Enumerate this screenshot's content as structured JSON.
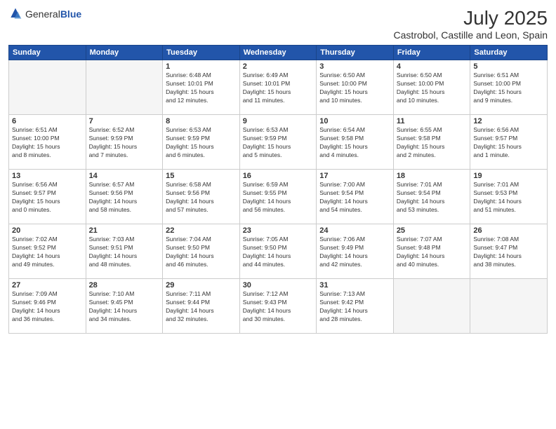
{
  "logo": {
    "general": "General",
    "blue": "Blue"
  },
  "title": "July 2025",
  "subtitle": "Castrobol, Castille and Leon, Spain",
  "weekdays": [
    "Sunday",
    "Monday",
    "Tuesday",
    "Wednesday",
    "Thursday",
    "Friday",
    "Saturday"
  ],
  "days": [
    {
      "num": "",
      "info": ""
    },
    {
      "num": "",
      "info": ""
    },
    {
      "num": "1",
      "info": "Sunrise: 6:48 AM\nSunset: 10:01 PM\nDaylight: 15 hours\nand 12 minutes."
    },
    {
      "num": "2",
      "info": "Sunrise: 6:49 AM\nSunset: 10:01 PM\nDaylight: 15 hours\nand 11 minutes."
    },
    {
      "num": "3",
      "info": "Sunrise: 6:50 AM\nSunset: 10:00 PM\nDaylight: 15 hours\nand 10 minutes."
    },
    {
      "num": "4",
      "info": "Sunrise: 6:50 AM\nSunset: 10:00 PM\nDaylight: 15 hours\nand 10 minutes."
    },
    {
      "num": "5",
      "info": "Sunrise: 6:51 AM\nSunset: 10:00 PM\nDaylight: 15 hours\nand 9 minutes."
    },
    {
      "num": "6",
      "info": "Sunrise: 6:51 AM\nSunset: 10:00 PM\nDaylight: 15 hours\nand 8 minutes."
    },
    {
      "num": "7",
      "info": "Sunrise: 6:52 AM\nSunset: 9:59 PM\nDaylight: 15 hours\nand 7 minutes."
    },
    {
      "num": "8",
      "info": "Sunrise: 6:53 AM\nSunset: 9:59 PM\nDaylight: 15 hours\nand 6 minutes."
    },
    {
      "num": "9",
      "info": "Sunrise: 6:53 AM\nSunset: 9:59 PM\nDaylight: 15 hours\nand 5 minutes."
    },
    {
      "num": "10",
      "info": "Sunrise: 6:54 AM\nSunset: 9:58 PM\nDaylight: 15 hours\nand 4 minutes."
    },
    {
      "num": "11",
      "info": "Sunrise: 6:55 AM\nSunset: 9:58 PM\nDaylight: 15 hours\nand 2 minutes."
    },
    {
      "num": "12",
      "info": "Sunrise: 6:56 AM\nSunset: 9:57 PM\nDaylight: 15 hours\nand 1 minute."
    },
    {
      "num": "13",
      "info": "Sunrise: 6:56 AM\nSunset: 9:57 PM\nDaylight: 15 hours\nand 0 minutes."
    },
    {
      "num": "14",
      "info": "Sunrise: 6:57 AM\nSunset: 9:56 PM\nDaylight: 14 hours\nand 58 minutes."
    },
    {
      "num": "15",
      "info": "Sunrise: 6:58 AM\nSunset: 9:56 PM\nDaylight: 14 hours\nand 57 minutes."
    },
    {
      "num": "16",
      "info": "Sunrise: 6:59 AM\nSunset: 9:55 PM\nDaylight: 14 hours\nand 56 minutes."
    },
    {
      "num": "17",
      "info": "Sunrise: 7:00 AM\nSunset: 9:54 PM\nDaylight: 14 hours\nand 54 minutes."
    },
    {
      "num": "18",
      "info": "Sunrise: 7:01 AM\nSunset: 9:54 PM\nDaylight: 14 hours\nand 53 minutes."
    },
    {
      "num": "19",
      "info": "Sunrise: 7:01 AM\nSunset: 9:53 PM\nDaylight: 14 hours\nand 51 minutes."
    },
    {
      "num": "20",
      "info": "Sunrise: 7:02 AM\nSunset: 9:52 PM\nDaylight: 14 hours\nand 49 minutes."
    },
    {
      "num": "21",
      "info": "Sunrise: 7:03 AM\nSunset: 9:51 PM\nDaylight: 14 hours\nand 48 minutes."
    },
    {
      "num": "22",
      "info": "Sunrise: 7:04 AM\nSunset: 9:50 PM\nDaylight: 14 hours\nand 46 minutes."
    },
    {
      "num": "23",
      "info": "Sunrise: 7:05 AM\nSunset: 9:50 PM\nDaylight: 14 hours\nand 44 minutes."
    },
    {
      "num": "24",
      "info": "Sunrise: 7:06 AM\nSunset: 9:49 PM\nDaylight: 14 hours\nand 42 minutes."
    },
    {
      "num": "25",
      "info": "Sunrise: 7:07 AM\nSunset: 9:48 PM\nDaylight: 14 hours\nand 40 minutes."
    },
    {
      "num": "26",
      "info": "Sunrise: 7:08 AM\nSunset: 9:47 PM\nDaylight: 14 hours\nand 38 minutes."
    },
    {
      "num": "27",
      "info": "Sunrise: 7:09 AM\nSunset: 9:46 PM\nDaylight: 14 hours\nand 36 minutes."
    },
    {
      "num": "28",
      "info": "Sunrise: 7:10 AM\nSunset: 9:45 PM\nDaylight: 14 hours\nand 34 minutes."
    },
    {
      "num": "29",
      "info": "Sunrise: 7:11 AM\nSunset: 9:44 PM\nDaylight: 14 hours\nand 32 minutes."
    },
    {
      "num": "30",
      "info": "Sunrise: 7:12 AM\nSunset: 9:43 PM\nDaylight: 14 hours\nand 30 minutes."
    },
    {
      "num": "31",
      "info": "Sunrise: 7:13 AM\nSunset: 9:42 PM\nDaylight: 14 hours\nand 28 minutes."
    },
    {
      "num": "",
      "info": ""
    },
    {
      "num": "",
      "info": ""
    },
    {
      "num": "",
      "info": ""
    },
    {
      "num": "",
      "info": ""
    },
    {
      "num": "",
      "info": ""
    }
  ]
}
